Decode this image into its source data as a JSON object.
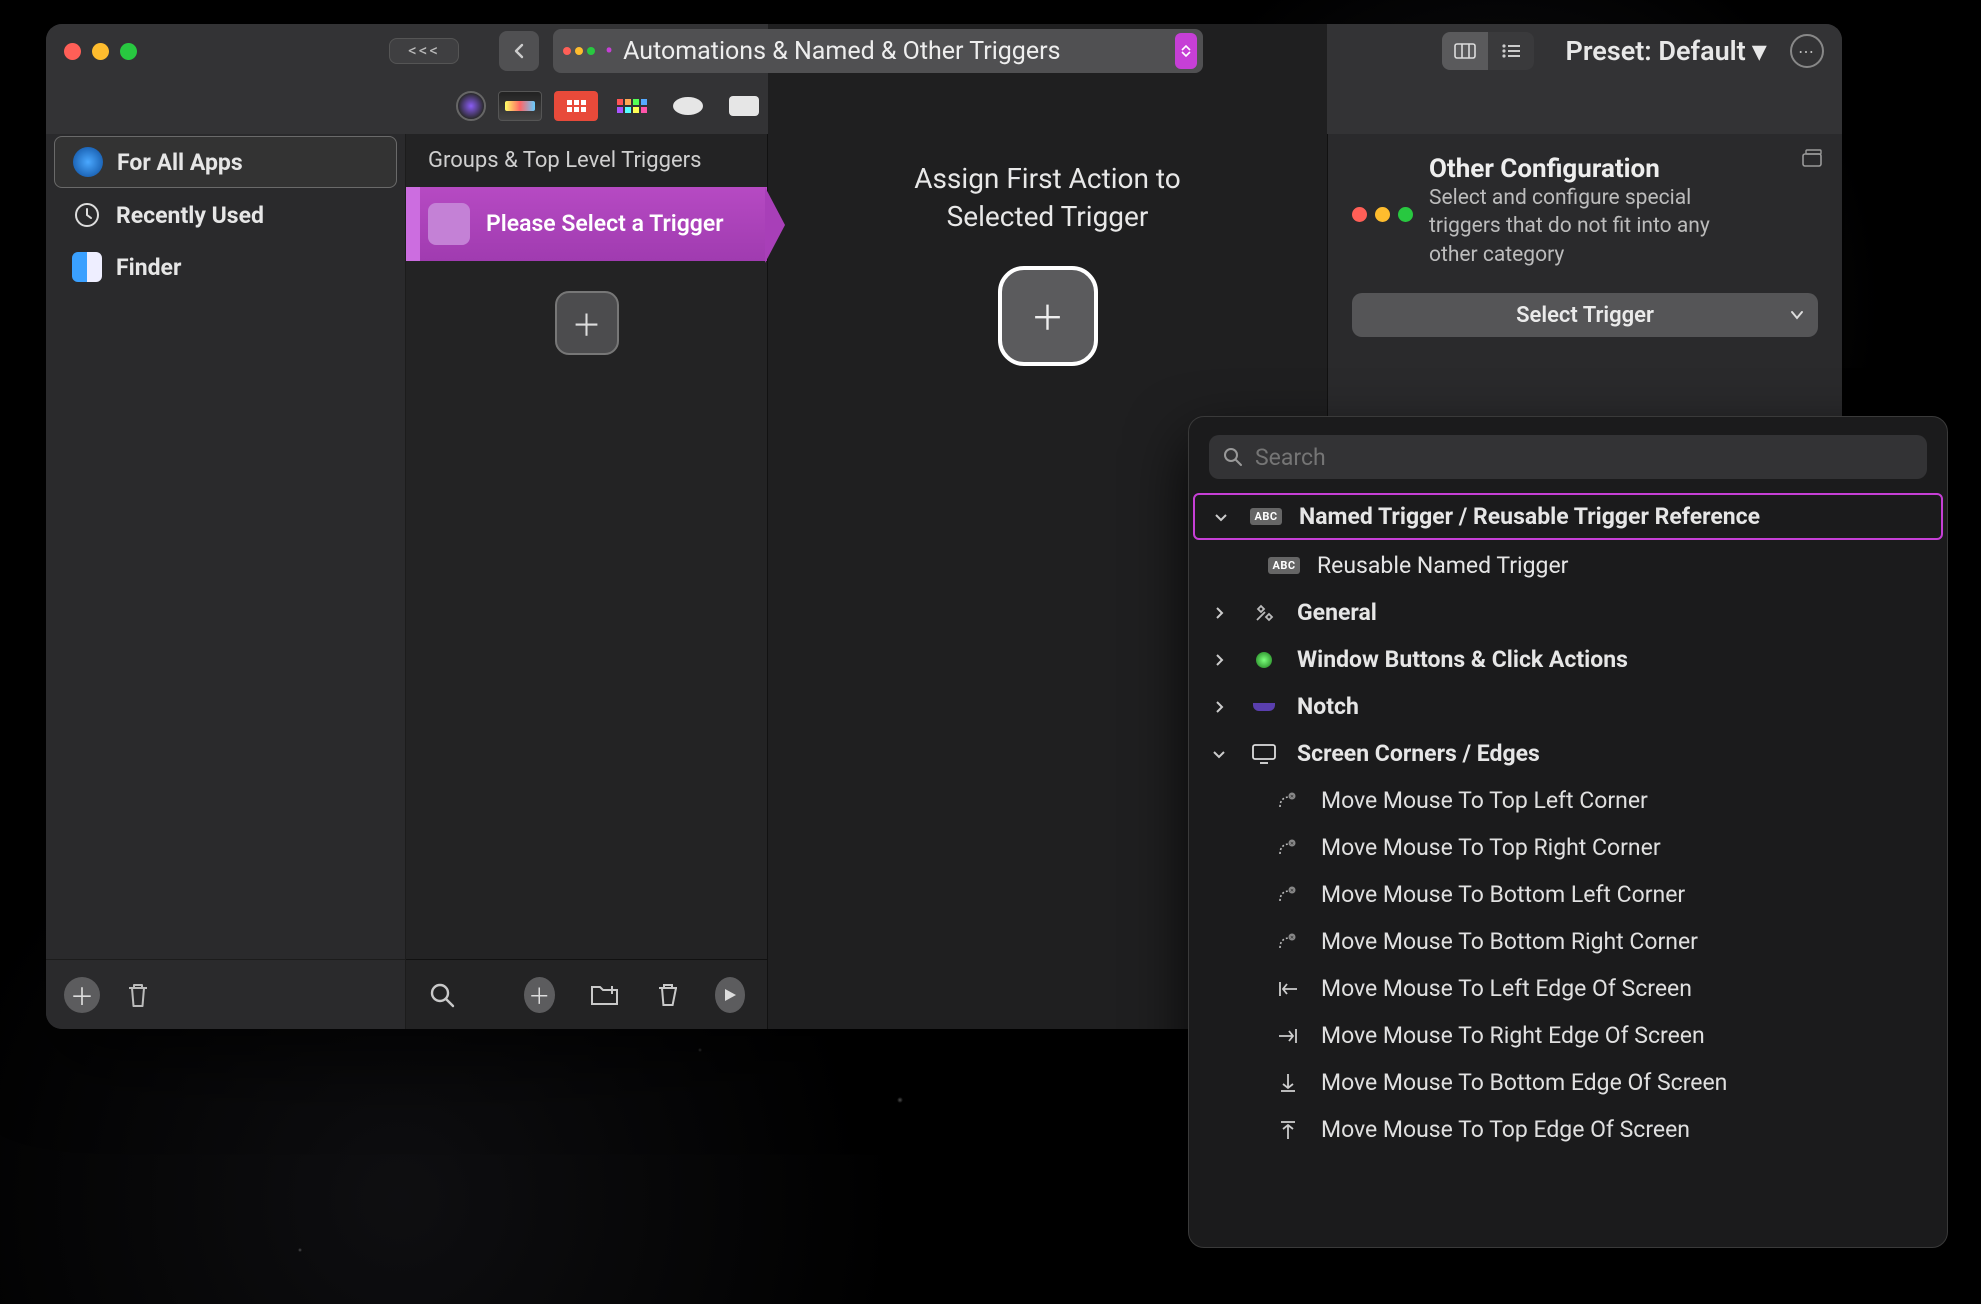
{
  "colors": {
    "accent": "#c63fd6"
  },
  "toolbar": {
    "collapse_label": "<<<",
    "section_title": "Automations & Named & Other Triggers",
    "preset_label": "Preset: Default ▾"
  },
  "sidebar": {
    "items": [
      {
        "label": "For All Apps"
      },
      {
        "label": "Recently Used"
      },
      {
        "label": "Finder"
      }
    ]
  },
  "triggers_col": {
    "header": "Groups & Top Level Triggers",
    "card_label": "Please Select a Trigger"
  },
  "actions_col": {
    "title_line1": "Assign First Action to",
    "title_line2": "Selected Trigger"
  },
  "config_col": {
    "title": "Other Configuration",
    "description": "Select and configure special triggers that do not  fit into any other category",
    "select_trigger_label": "Select Trigger"
  },
  "popover": {
    "search_placeholder": "Search",
    "groups": [
      {
        "label": "Named Trigger / Reusable Trigger Reference",
        "expanded": true,
        "highlight": true,
        "icon": "abc",
        "children": [
          {
            "label": "Reusable Named Trigger",
            "icon": "abc"
          }
        ]
      },
      {
        "label": "General",
        "expanded": false,
        "icon": "tools"
      },
      {
        "label": "Window Buttons & Click Actions",
        "expanded": false,
        "icon": "green-dot"
      },
      {
        "label": "Notch",
        "expanded": false,
        "icon": "notch"
      },
      {
        "label": "Screen Corners / Edges",
        "expanded": true,
        "icon": "monitor",
        "children": [
          {
            "label": "Move Mouse To Top Left Corner",
            "icon": "corner"
          },
          {
            "label": "Move Mouse To Top Right Corner",
            "icon": "corner"
          },
          {
            "label": "Move Mouse To Bottom Left Corner",
            "icon": "corner"
          },
          {
            "label": "Move Mouse To Bottom Right Corner",
            "icon": "corner"
          },
          {
            "label": "Move Mouse To Left Edge Of Screen",
            "icon": "edge-left"
          },
          {
            "label": "Move Mouse To Right Edge Of Screen",
            "icon": "edge-right"
          },
          {
            "label": "Move Mouse To Bottom Edge Of Screen",
            "icon": "edge-down"
          },
          {
            "label": "Move Mouse To Top Edge Of Screen",
            "icon": "edge-up"
          }
        ]
      }
    ]
  }
}
